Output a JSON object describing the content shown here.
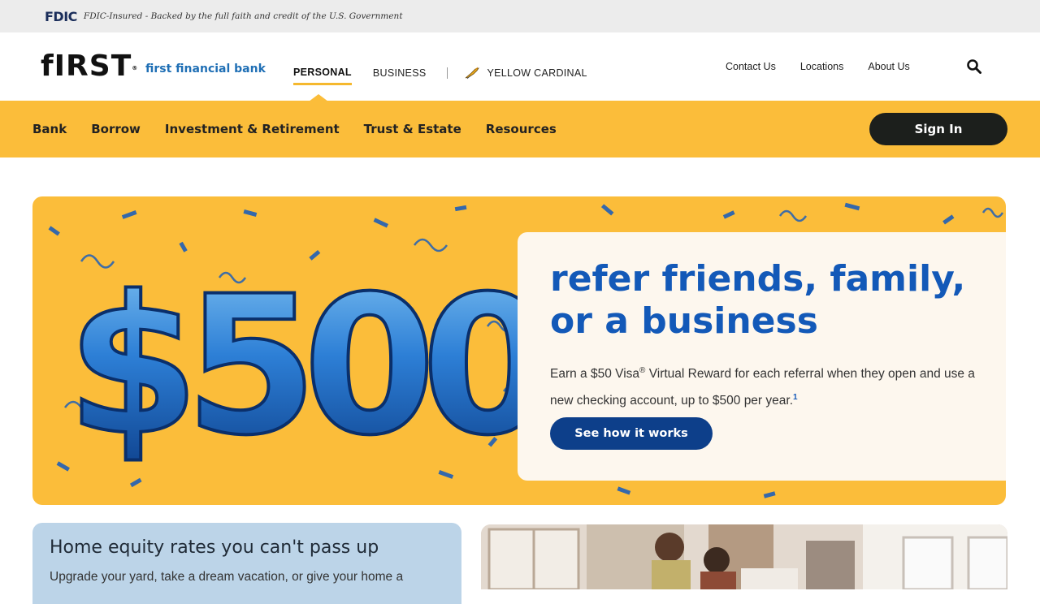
{
  "fdic": {
    "logo": "FDIC",
    "notice": "FDIC-Insured - Backed by the full faith and credit of the U.S. Government"
  },
  "header": {
    "logo_text": "fIRST",
    "logo_mark": "®",
    "logo_subtitle": "first financial bank",
    "segments": [
      "PERSONAL",
      "BUSINESS"
    ],
    "cardinal_label": "YELLOW CARDINAL",
    "links": [
      "Contact Us",
      "Locations",
      "About Us"
    ],
    "search_icon": "search-icon"
  },
  "main_nav": {
    "items": [
      "Bank",
      "Borrow",
      "Investment & Retirement",
      "Trust & Estate",
      "Resources"
    ],
    "signin_label": "Sign In"
  },
  "hero": {
    "image_text": "$500",
    "title_line1": "refer friends, family,",
    "title_line2": "or a business",
    "body_part1": "Earn a $50 Visa",
    "body_reg": "®",
    "body_part2": " Virtual Reward for each referral when they open and use a new checking account, up to $500 per year.",
    "body_footnote": "1",
    "cta_label": "See how it works"
  },
  "equity": {
    "title": "Home equity rates you can't pass up",
    "body": "Upgrade your yard, take a dream vacation, or give your home a"
  },
  "colors": {
    "brand_yellow": "#fbbd3a",
    "brand_blue": "#1359b8",
    "cta_navy": "#0d3f8a",
    "signin_dark": "#1c1f1c",
    "equity_bg": "#bcd4e8"
  }
}
